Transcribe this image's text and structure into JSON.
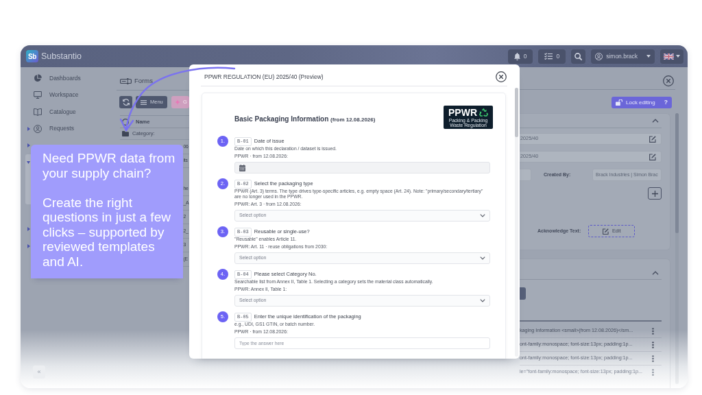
{
  "app": {
    "logo": "Sb",
    "name": "Substantio"
  },
  "topbar": {
    "notifications": "0",
    "tasks": "0",
    "user": "simon.brack"
  },
  "sidebar": {
    "items": [
      {
        "kind": "link",
        "label": "Dashboards"
      },
      {
        "kind": "link",
        "label": "Workspace"
      },
      {
        "kind": "link",
        "label": "Catalogue"
      },
      {
        "kind": "group",
        "label": "Requests",
        "expanded": false
      },
      {
        "kind": "group",
        "expanded": false
      },
      {
        "kind": "group",
        "expanded": true
      },
      {
        "kind": "group",
        "expanded": false
      },
      {
        "kind": "group",
        "expanded": false
      }
    ],
    "collapse_button": "«"
  },
  "forms_panel": {
    "title": "Forms",
    "toolbar": [
      {
        "kind": "refresh"
      },
      {
        "kind": "menu",
        "label": "Menu"
      },
      {
        "kind": "ai",
        "label": "G"
      }
    ],
    "table": {
      "columns": [
        "Name"
      ],
      "rows": [
        {
          "kind": "category",
          "column_1": "Category:"
        },
        {
          "kind": "item",
          "column_2": "06"
        },
        {
          "kind": "item",
          "column_2": "its"
        },
        {
          "kind": "item",
          "column_2": "he"
        },
        {
          "kind": "item",
          "column_2": "_A"
        },
        {
          "kind": "item",
          "column_2": "2"
        },
        {
          "kind": "item",
          "column_2": "2_"
        },
        {
          "kind": "item",
          "column_2": "3"
        },
        {
          "kind": "item",
          "column_2": "(E"
        }
      ]
    }
  },
  "callout": {
    "heading": "Need PPWR data from your supply chain?",
    "body": "Create the right questions in just a few clicks – supported by reviewed templates and AI."
  },
  "modal": {
    "title": "PPWR REGULATION (EU) 2025/40 (Preview)",
    "form_title": "Basic Packaging Information",
    "form_title_note": "(from 12.08.2026)",
    "logo": {
      "text": "PPWR",
      "subtitle": "Packing & Packing Waste Regulation"
    },
    "questions": [
      {
        "number": "1.",
        "code": "B-01",
        "label": "Date of issue",
        "description": "Date on which this declaration / dataset is issued.",
        "reference": "PPWR · from 12.08.2026:",
        "field": {
          "kind": "date"
        }
      },
      {
        "number": "2.",
        "code": "B-02",
        "label": "Select the packaging type",
        "description": "PPWR (Art. 3) terms. The type drives type-specific articles, e.g. empty space (Art. 24). Note: \"primary/secondary/tertiary\" are no longer used in the PPWR.",
        "reference": "PPWR: Art. 3 · from 12.08.2026:",
        "field": {
          "kind": "select",
          "placeholder": "Select option"
        }
      },
      {
        "number": "3.",
        "code": "B-03",
        "label": "Reusable or single-use?",
        "description": "\"Reusable\" enables Article 11.",
        "reference": "PPWR: Art. 11 · reuse obligations from 2030:",
        "field": {
          "kind": "select",
          "placeholder": "Select option"
        }
      },
      {
        "number": "4.",
        "code": "B-04",
        "label": "Please select Category No.",
        "description": "Searchable list from Annex II, Table 1. Selecting a category sets the material class automatically.",
        "reference": "PPWR: Annex II, Table 1:",
        "field": {
          "kind": "select",
          "placeholder": "Select option"
        }
      },
      {
        "number": "5.",
        "code": "B-05",
        "label": "Enter the unique identification of the packaging",
        "description": "e.g., UDI, GS1 GTIN, or batch number.",
        "reference": "PPWR · from 12.08.2026:",
        "field": {
          "kind": "text",
          "placeholder": "Type the answer here"
        }
      }
    ]
  },
  "detail_panel": {
    "lock_button": {
      "label": "Lock editing",
      "help": "?"
    },
    "cards": [
      {
        "kind": "general",
        "expanded": true,
        "fields": [
          "2025/40",
          "2025/40"
        ],
        "created_by_label": "Created By:",
        "created_by": "Brack Industries | Simon Brac",
        "acknowledge_label": "Acknowledge Text:",
        "acknowledge_button": "Edit"
      },
      {
        "kind": "content",
        "expanded": true,
        "rows": [
          "kaging Information <small>(from 12.08.2026)</sm...",
          "ont-family:monospace; font-size:13px; padding:1p...",
          "ont-family:monospace; font-size:13px; padding:1p...",
          "le=\"font-family:monospace; font-size:13px; padding:1p..."
        ]
      }
    ]
  }
}
